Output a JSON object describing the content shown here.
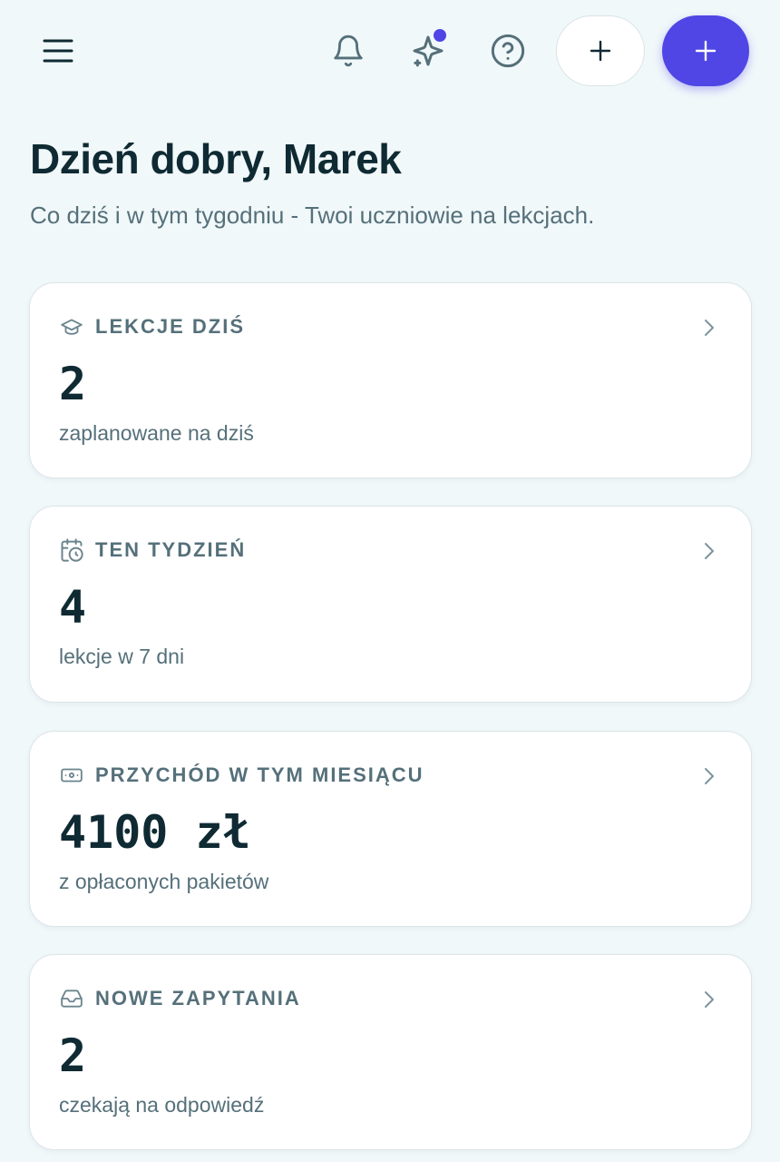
{
  "header": {
    "icons": {
      "menu": "menu-icon",
      "notifications": "bell-icon",
      "ai": "sparkle-icon",
      "help": "help-icon",
      "add_secondary": "plus-icon",
      "add_primary": "plus-icon"
    },
    "ai_badge_color": "#4f46e5",
    "primary_color": "#4f46e5"
  },
  "greeting": {
    "title": "Dzień dobry, Marek",
    "subtitle": "Co dziś i w tym tygodniu - Twoi uczniowie na lekcjach."
  },
  "cards": [
    {
      "icon": "graduation-cap-icon",
      "title": "LEKCJE DZIŚ",
      "value": "2",
      "caption": "zaplanowane na dziś"
    },
    {
      "icon": "calendar-clock-icon",
      "title": "TEN TYDZIEŃ",
      "value": "4",
      "caption": "lekcje w 7 dni"
    },
    {
      "icon": "banknote-icon",
      "title": "PRZYCHÓD W TYM MIESIĄCU",
      "value": "4100 zł",
      "caption": "z opłaconych pakietów"
    },
    {
      "icon": "inbox-icon",
      "title": "NOWE ZAPYTANIA",
      "value": "2",
      "caption": "czekają na odpowiedź"
    }
  ]
}
